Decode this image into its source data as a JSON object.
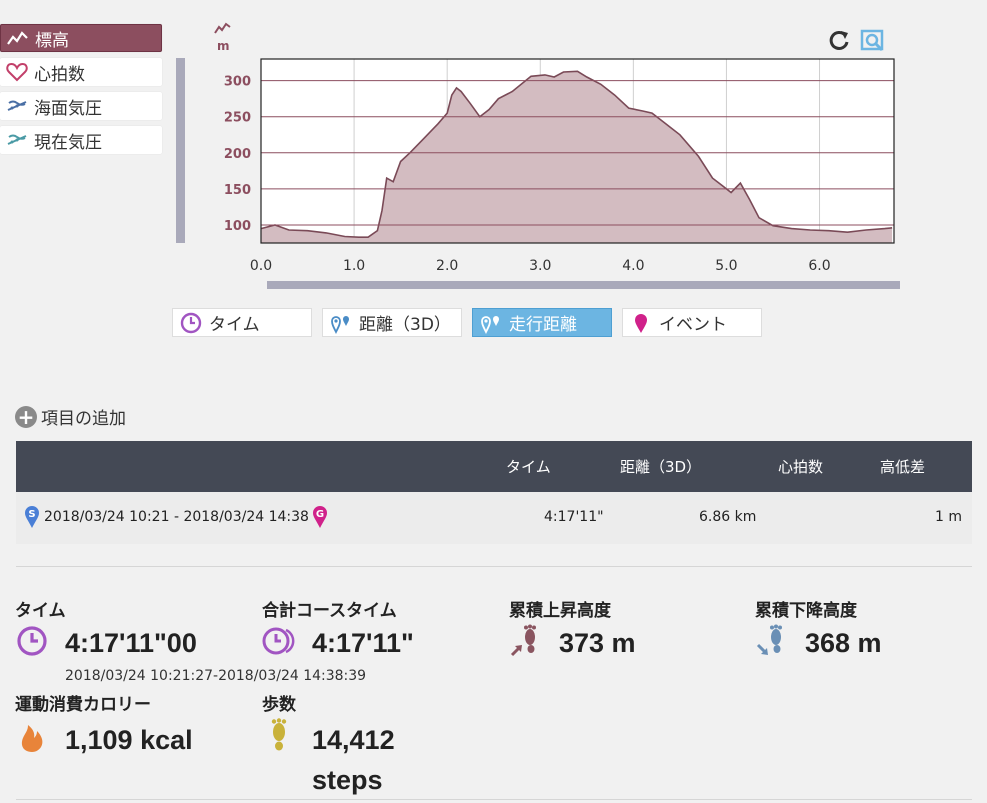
{
  "series_selector": [
    {
      "label": "標高",
      "icon": "elevation-icon",
      "active": true
    },
    {
      "label": "心拍数",
      "icon": "heart-icon",
      "active": false
    },
    {
      "label": "海面気圧",
      "icon": "pressure-sea-icon",
      "active": false
    },
    {
      "label": "現在気圧",
      "icon": "pressure-current-icon",
      "active": false
    }
  ],
  "chart_unit": "m",
  "tool_icons": [
    "reset-icon",
    "zoom-icon"
  ],
  "chart_data": {
    "type": "area",
    "title": "",
    "xlabel": "",
    "ylabel": "m",
    "xlim": [
      0,
      6.8
    ],
    "ylim": [
      75,
      330
    ],
    "x_ticks": [
      "0.0",
      "1.0",
      "2.0",
      "3.0",
      "4.0",
      "5.0",
      "6.0"
    ],
    "y_ticks": [
      "100",
      "150",
      "200",
      "250",
      "300"
    ],
    "grid": true,
    "colors": {
      "line": "#7a4a57",
      "fill": "#d3bcc1",
      "grid": "#8c4e5f"
    },
    "series": [
      {
        "x": [
          0.0,
          0.15,
          0.3,
          0.5,
          0.7,
          0.9,
          1.05,
          1.15,
          1.25,
          1.3,
          1.35,
          1.42,
          1.5,
          1.6,
          1.75,
          1.9,
          2.0,
          2.05,
          2.1,
          2.15,
          2.25,
          2.35,
          2.45,
          2.55,
          2.7,
          2.9,
          3.05,
          3.15,
          3.25,
          3.4,
          3.5,
          3.65,
          3.8,
          3.95,
          4.1,
          4.2,
          4.35,
          4.5,
          4.7,
          4.85,
          4.95,
          5.05,
          5.15,
          5.25,
          5.35,
          5.5,
          5.7,
          5.9,
          6.1,
          6.3,
          6.5,
          6.7,
          6.78
        ],
        "y": [
          95,
          100,
          93,
          92,
          89,
          84,
          83,
          83,
          92,
          120,
          165,
          160,
          188,
          200,
          220,
          240,
          255,
          280,
          290,
          285,
          268,
          250,
          260,
          275,
          285,
          306,
          308,
          305,
          312,
          313,
          305,
          295,
          280,
          262,
          258,
          255,
          240,
          225,
          195,
          165,
          155,
          145,
          158,
          135,
          110,
          99,
          95,
          93,
          92,
          90,
          93,
          95,
          96
        ]
      }
    ]
  },
  "axis_buttons": [
    {
      "label": "タイム",
      "icon": "clock-icon",
      "active": false
    },
    {
      "label": "距離（3D）",
      "icon": "distance-3d-icon",
      "active": false
    },
    {
      "label": "走行距離",
      "icon": "travel-distance-icon",
      "active": true
    },
    {
      "label": "イベント",
      "icon": "event-pin-icon",
      "active": false
    }
  ],
  "add_item_label": "項目の追加",
  "table": {
    "headers": [
      "タイム",
      "距離（3D）",
      "心拍数",
      "高低差"
    ],
    "row": {
      "start_badge": "S",
      "end_badge": "G",
      "range": "2018/03/24 10:21 - 2018/03/24 14:38",
      "time": "4:17'11\"",
      "distance": "6.86 km",
      "heart_rate": "",
      "elevation_diff": "1 m"
    }
  },
  "stats": {
    "time": {
      "label": "タイム",
      "value": "4:17'11\"00",
      "sub": "2018/03/24 10:21:27-2018/03/24 14:38:39"
    },
    "course_time": {
      "label": "合計コースタイム",
      "value": "4:17'11\""
    },
    "ascent": {
      "label": "累積上昇高度",
      "value": "373 m"
    },
    "descent": {
      "label": "累積下降高度",
      "value": "368 m"
    },
    "calories": {
      "label": "運動消費カロリー",
      "value": "1,109 kcal"
    },
    "steps": {
      "label": "歩数",
      "value": "14,412",
      "unit": "steps"
    }
  },
  "colors": {
    "accent_elevation": "#8c4e5f",
    "accent_blue": "#6cb5e2",
    "clock_purple": "#a155c2",
    "flame_orange": "#e8843a",
    "ascent_brown": "#8a5560",
    "descent_blue": "#6a8fb5",
    "steps_yellow": "#c9b23a",
    "table_header": "#444955"
  }
}
